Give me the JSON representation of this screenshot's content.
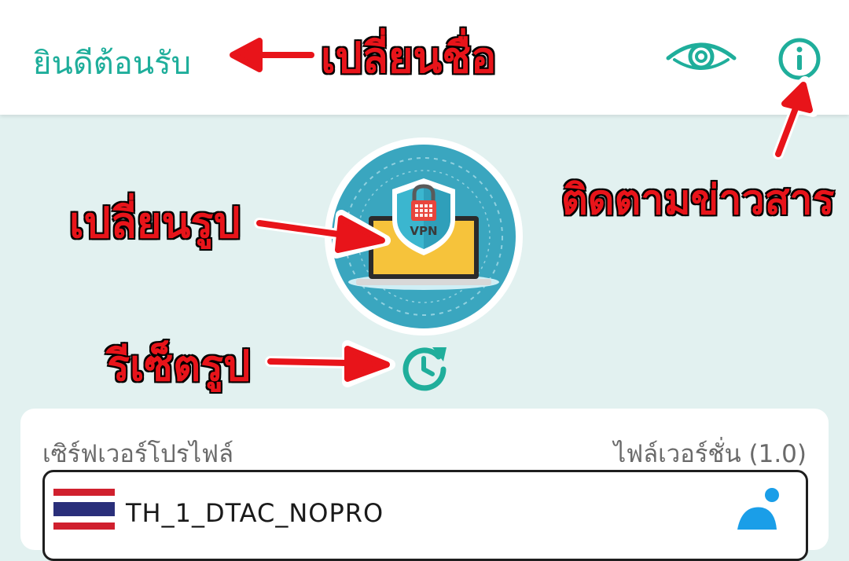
{
  "header": {
    "title": "ยินดีต้อนรับ",
    "eye_icon": "eye-icon",
    "info_icon": "info-icon"
  },
  "avatar": {
    "image": "vpn-laptop-shield-illustration",
    "badge_text": "VPN"
  },
  "reset_icon": "reset-history-icon",
  "annotations": {
    "change_name": "เปลี่ยนชื่อ",
    "follow_news": "ติดตามข่าวสาร",
    "change_image": "เปลี่ยนรูป",
    "reset_image": "รีเซ็ตรูป"
  },
  "card": {
    "server_profile_label": "เซิร์ฟเวอร์โปรไฟล์",
    "file_version_label": "ไฟล์เวอร์ชั่น (1.0)",
    "server": {
      "name": "TH_1_DTAC_NOPRO",
      "flag": "thailand-flag",
      "carrier_icon": "dtac-logo-icon"
    }
  },
  "colors": {
    "accent": "#1fae9b",
    "background": "#e2f1f0",
    "annotation": "#e8141a"
  }
}
